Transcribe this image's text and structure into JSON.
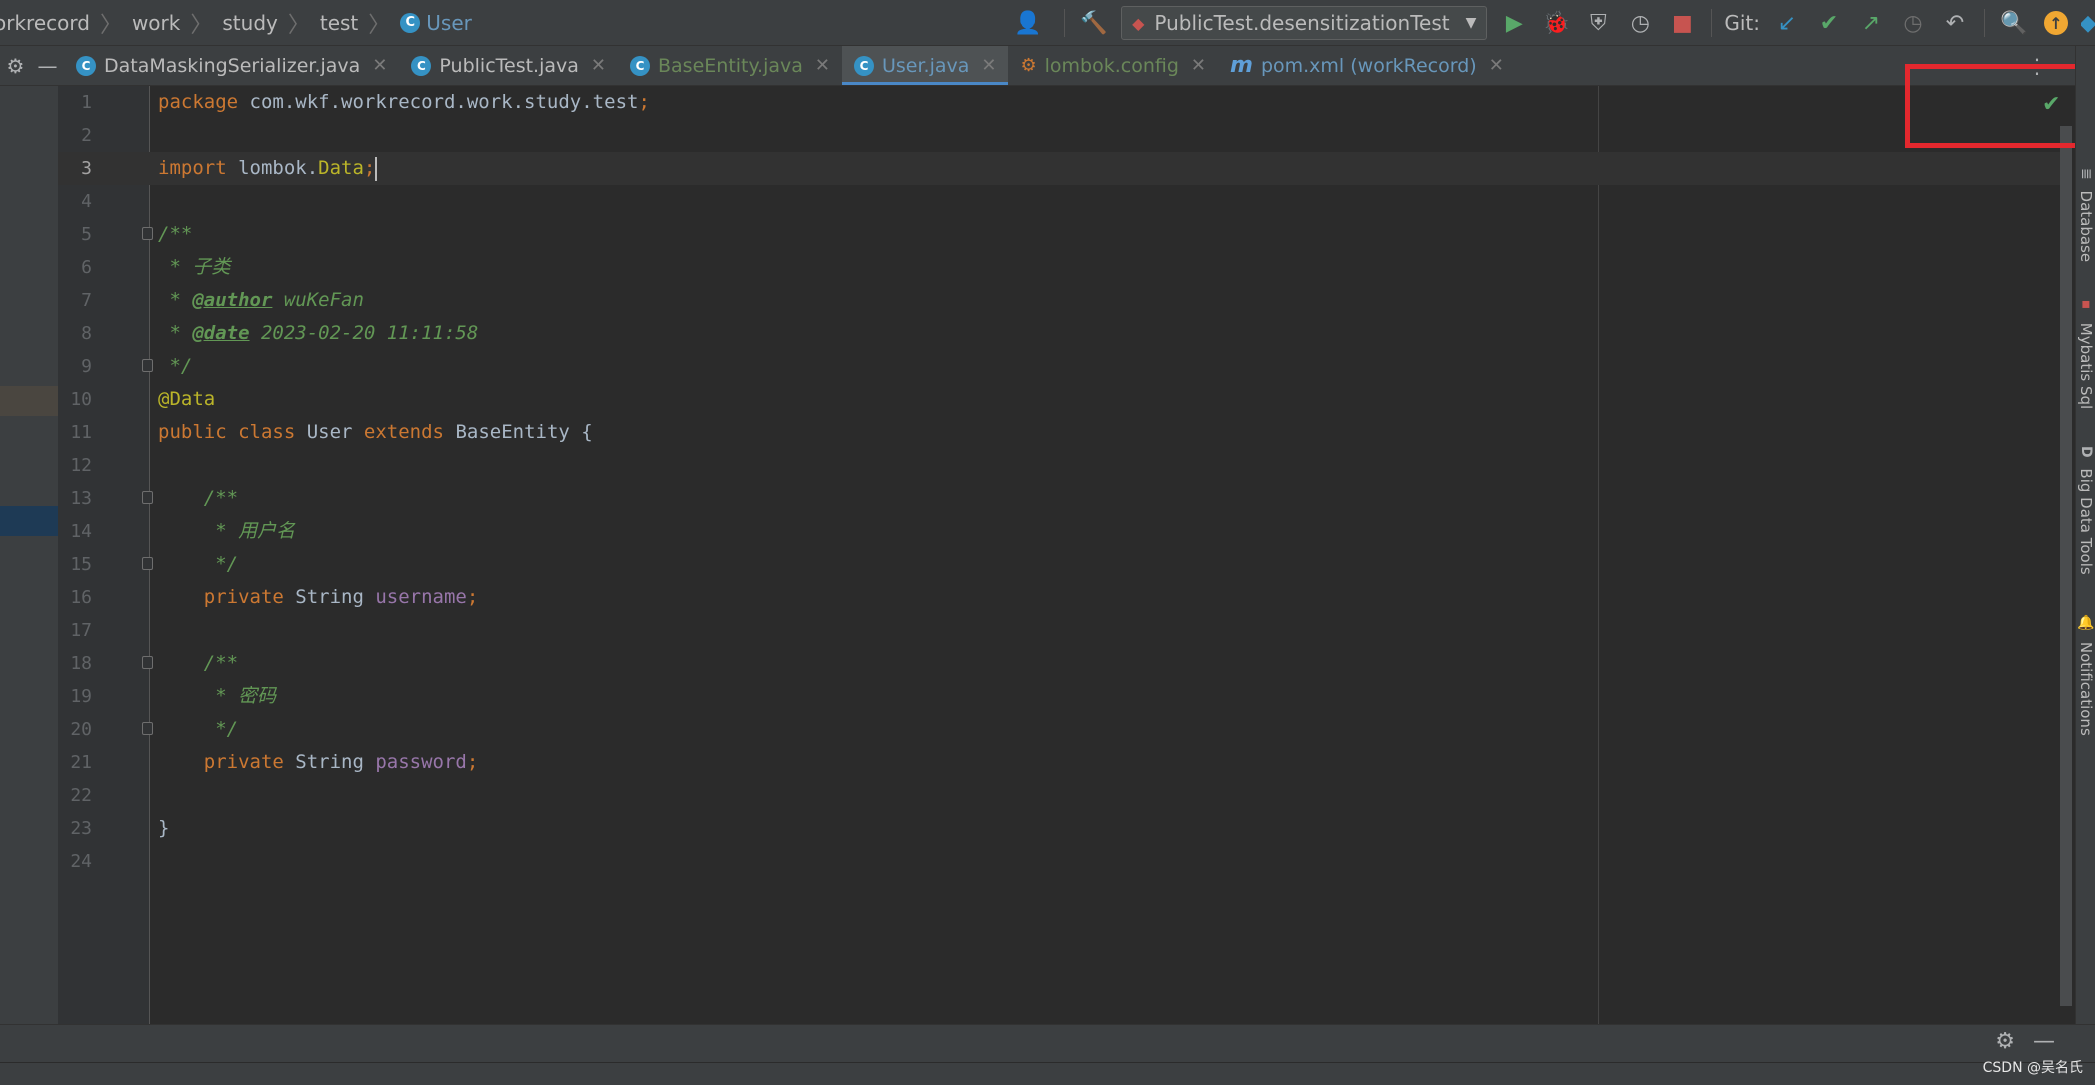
{
  "breadcrumb": {
    "items": [
      "orkrecord",
      "work",
      "study",
      "test"
    ],
    "current": "User",
    "current_badge": "C"
  },
  "toolbar": {
    "run_config": "PublicTest.desensitizationTest",
    "git_label": "Git:",
    "icons": {
      "user": "👤",
      "build": "🔨",
      "run": "▶",
      "debug": "🐞",
      "coverage": "⛨",
      "profile": "◷",
      "stop": "■",
      "git_update": "↙",
      "git_commit": "✔",
      "git_push": "↗",
      "history": "◷",
      "rollback": "↶",
      "search": "🔍",
      "updates": "↑"
    }
  },
  "tabs": [
    {
      "label": "DataMaskingSerializer.java",
      "badge": "C",
      "close": "✕"
    },
    {
      "label": "PublicTest.java",
      "badge": "C",
      "close": "✕"
    },
    {
      "label": "BaseEntity.java",
      "badge": "C",
      "close": "✕"
    },
    {
      "label": "User.java",
      "badge": "C",
      "close": "✕"
    },
    {
      "label": "lombok.config",
      "badge": "⚙",
      "close": "✕"
    },
    {
      "label": "pom.xml (workRecord)",
      "badge": "m",
      "close": "✕"
    }
  ],
  "tabbar": {
    "settings_icon": "⚙",
    "minimize_icon": "—",
    "menu_icon": "⋮"
  },
  "editor": {
    "line_numbers": [
      "1",
      "2",
      "3",
      "4",
      "5",
      "6",
      "7",
      "8",
      "9",
      "10",
      "11",
      "12",
      "13",
      "14",
      "15",
      "16",
      "17",
      "18",
      "19",
      "20",
      "21",
      "22",
      "23",
      "24"
    ],
    "tokens": {
      "package": "package",
      "package_name": " com.wkf.workrecord.work.study.test",
      "semicolon": ";",
      "import": "import",
      "import_pkg": " lombok.",
      "import_class": "Data",
      "doc_open": "/**",
      "doc_desc": " * 子类",
      "doc_star": " * ",
      "author_tag": "@author",
      "author_val": " wuKeFan",
      "date_tag": "@date",
      "date_val": " 2023-02-20 11:11:58",
      "doc_close": " */",
      "annotation": "@Data",
      "public": "public",
      "class": " class",
      "class_name": " User ",
      "extends": "extends",
      "parent": " BaseEntity {",
      "inner_doc_open": "    /**",
      "username_doc": "     * 用户名",
      "inner_doc_close": "     */",
      "private": "    private",
      "type": " String ",
      "username": "username",
      "password_doc": "     * 密码",
      "password": "password",
      "close_brace": "}"
    },
    "inspection_icon": "✔"
  },
  "right_tools": [
    {
      "label": "Database",
      "icon": "≣"
    },
    {
      "label": "Mybatis Sql",
      "icon": "▪"
    },
    {
      "label": "Big Data Tools",
      "icon": "D"
    },
    {
      "label": "Notifications",
      "icon": "🔔"
    }
  ],
  "bottom": {
    "settings_icon": "⚙",
    "minimize_icon": "—"
  },
  "watermark": "CSDN @吴名氏",
  "colors": {
    "accent": "#4a88c7",
    "highlight_box": "#e4282e",
    "inspection_ok": "#59a869"
  }
}
